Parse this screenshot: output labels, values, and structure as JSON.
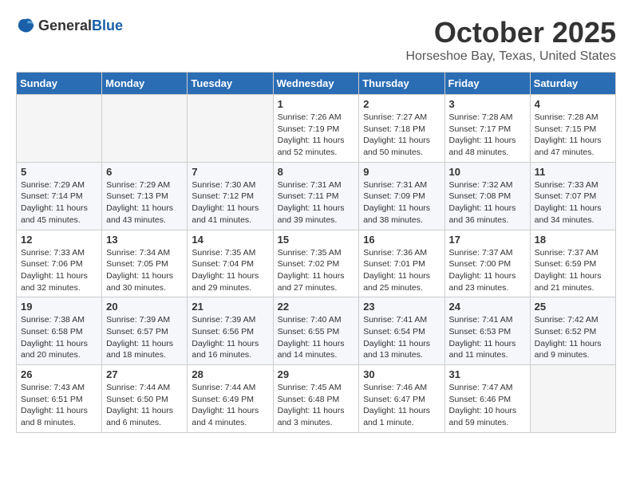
{
  "logo": {
    "general": "General",
    "blue": "Blue"
  },
  "header": {
    "month": "October 2025",
    "location": "Horseshoe Bay, Texas, United States"
  },
  "weekdays": [
    "Sunday",
    "Monday",
    "Tuesday",
    "Wednesday",
    "Thursday",
    "Friday",
    "Saturday"
  ],
  "weeks": [
    [
      {
        "day": "",
        "content": ""
      },
      {
        "day": "",
        "content": ""
      },
      {
        "day": "",
        "content": ""
      },
      {
        "day": "1",
        "content": "Sunrise: 7:26 AM\nSunset: 7:19 PM\nDaylight: 11 hours and 52 minutes."
      },
      {
        "day": "2",
        "content": "Sunrise: 7:27 AM\nSunset: 7:18 PM\nDaylight: 11 hours and 50 minutes."
      },
      {
        "day": "3",
        "content": "Sunrise: 7:28 AM\nSunset: 7:17 PM\nDaylight: 11 hours and 48 minutes."
      },
      {
        "day": "4",
        "content": "Sunrise: 7:28 AM\nSunset: 7:15 PM\nDaylight: 11 hours and 47 minutes."
      }
    ],
    [
      {
        "day": "5",
        "content": "Sunrise: 7:29 AM\nSunset: 7:14 PM\nDaylight: 11 hours and 45 minutes."
      },
      {
        "day": "6",
        "content": "Sunrise: 7:29 AM\nSunset: 7:13 PM\nDaylight: 11 hours and 43 minutes."
      },
      {
        "day": "7",
        "content": "Sunrise: 7:30 AM\nSunset: 7:12 PM\nDaylight: 11 hours and 41 minutes."
      },
      {
        "day": "8",
        "content": "Sunrise: 7:31 AM\nSunset: 7:11 PM\nDaylight: 11 hours and 39 minutes."
      },
      {
        "day": "9",
        "content": "Sunrise: 7:31 AM\nSunset: 7:09 PM\nDaylight: 11 hours and 38 minutes."
      },
      {
        "day": "10",
        "content": "Sunrise: 7:32 AM\nSunset: 7:08 PM\nDaylight: 11 hours and 36 minutes."
      },
      {
        "day": "11",
        "content": "Sunrise: 7:33 AM\nSunset: 7:07 PM\nDaylight: 11 hours and 34 minutes."
      }
    ],
    [
      {
        "day": "12",
        "content": "Sunrise: 7:33 AM\nSunset: 7:06 PM\nDaylight: 11 hours and 32 minutes."
      },
      {
        "day": "13",
        "content": "Sunrise: 7:34 AM\nSunset: 7:05 PM\nDaylight: 11 hours and 30 minutes."
      },
      {
        "day": "14",
        "content": "Sunrise: 7:35 AM\nSunset: 7:04 PM\nDaylight: 11 hours and 29 minutes."
      },
      {
        "day": "15",
        "content": "Sunrise: 7:35 AM\nSunset: 7:02 PM\nDaylight: 11 hours and 27 minutes."
      },
      {
        "day": "16",
        "content": "Sunrise: 7:36 AM\nSunset: 7:01 PM\nDaylight: 11 hours and 25 minutes."
      },
      {
        "day": "17",
        "content": "Sunrise: 7:37 AM\nSunset: 7:00 PM\nDaylight: 11 hours and 23 minutes."
      },
      {
        "day": "18",
        "content": "Sunrise: 7:37 AM\nSunset: 6:59 PM\nDaylight: 11 hours and 21 minutes."
      }
    ],
    [
      {
        "day": "19",
        "content": "Sunrise: 7:38 AM\nSunset: 6:58 PM\nDaylight: 11 hours and 20 minutes."
      },
      {
        "day": "20",
        "content": "Sunrise: 7:39 AM\nSunset: 6:57 PM\nDaylight: 11 hours and 18 minutes."
      },
      {
        "day": "21",
        "content": "Sunrise: 7:39 AM\nSunset: 6:56 PM\nDaylight: 11 hours and 16 minutes."
      },
      {
        "day": "22",
        "content": "Sunrise: 7:40 AM\nSunset: 6:55 PM\nDaylight: 11 hours and 14 minutes."
      },
      {
        "day": "23",
        "content": "Sunrise: 7:41 AM\nSunset: 6:54 PM\nDaylight: 11 hours and 13 minutes."
      },
      {
        "day": "24",
        "content": "Sunrise: 7:41 AM\nSunset: 6:53 PM\nDaylight: 11 hours and 11 minutes."
      },
      {
        "day": "25",
        "content": "Sunrise: 7:42 AM\nSunset: 6:52 PM\nDaylight: 11 hours and 9 minutes."
      }
    ],
    [
      {
        "day": "26",
        "content": "Sunrise: 7:43 AM\nSunset: 6:51 PM\nDaylight: 11 hours and 8 minutes."
      },
      {
        "day": "27",
        "content": "Sunrise: 7:44 AM\nSunset: 6:50 PM\nDaylight: 11 hours and 6 minutes."
      },
      {
        "day": "28",
        "content": "Sunrise: 7:44 AM\nSunset: 6:49 PM\nDaylight: 11 hours and 4 minutes."
      },
      {
        "day": "29",
        "content": "Sunrise: 7:45 AM\nSunset: 6:48 PM\nDaylight: 11 hours and 3 minutes."
      },
      {
        "day": "30",
        "content": "Sunrise: 7:46 AM\nSunset: 6:47 PM\nDaylight: 11 hours and 1 minute."
      },
      {
        "day": "31",
        "content": "Sunrise: 7:47 AM\nSunset: 6:46 PM\nDaylight: 10 hours and 59 minutes."
      },
      {
        "day": "",
        "content": ""
      }
    ]
  ]
}
